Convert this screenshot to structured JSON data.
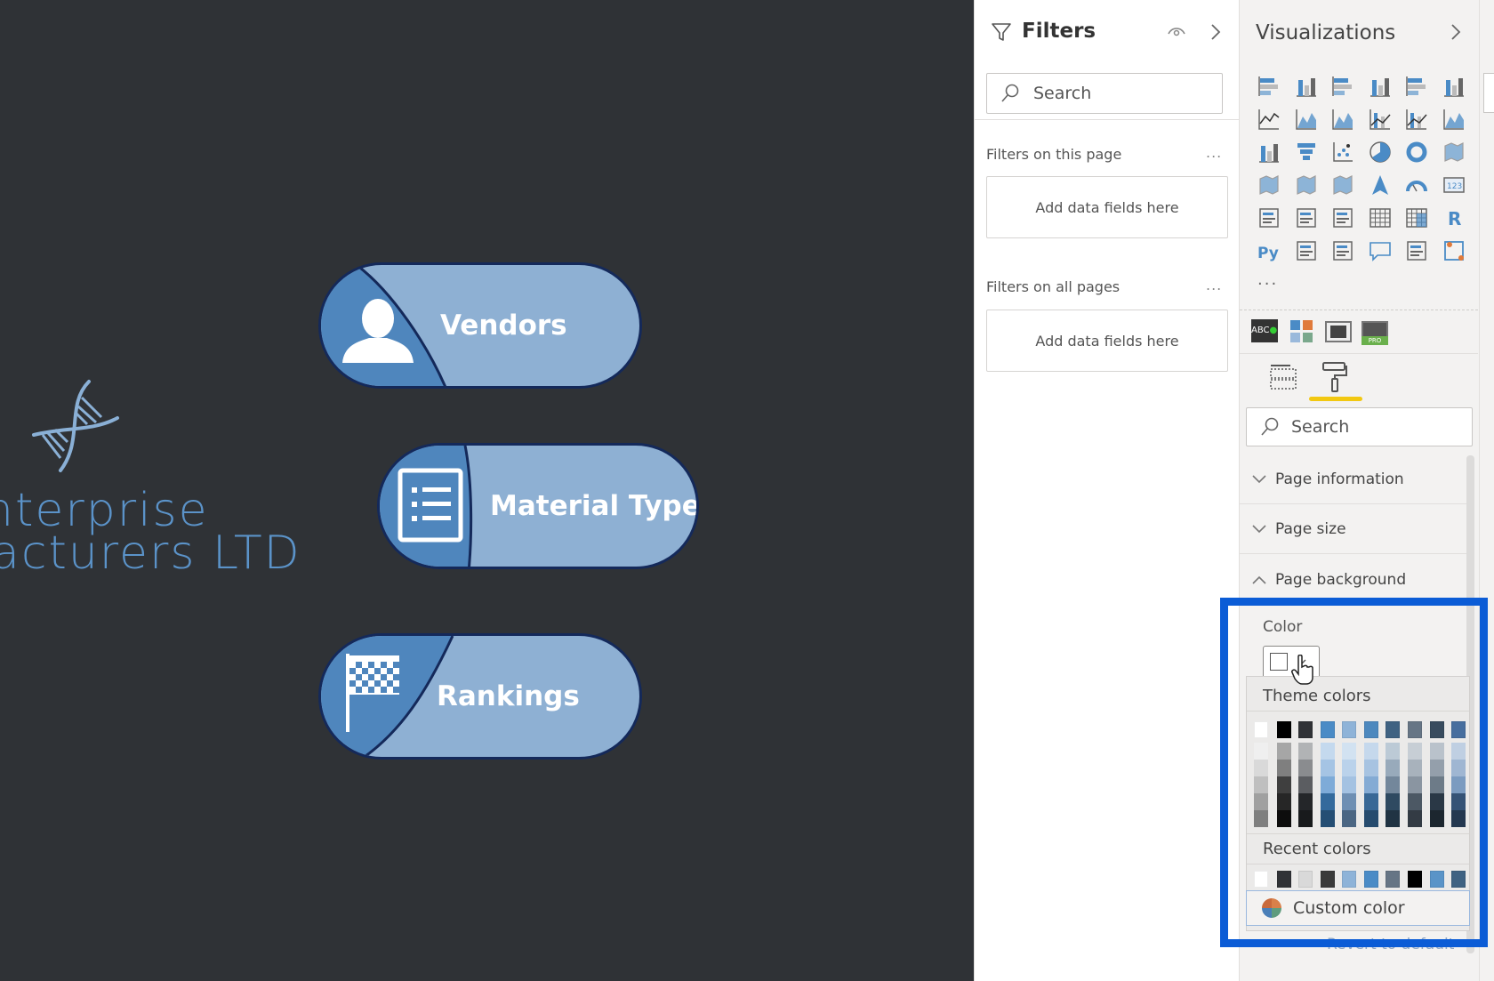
{
  "canvas": {
    "background_color": "#2f3236",
    "logo": {
      "line1": "nterprise",
      "line2": "acturers LTD",
      "icon": "dna-icon",
      "color": "#5b93c9"
    },
    "nav_buttons": [
      {
        "label": "Vendors",
        "icon": "person-icon"
      },
      {
        "label": "Material Type",
        "icon": "list-icon"
      },
      {
        "label": "Rankings",
        "icon": "checkered-flag-icon"
      }
    ],
    "pill_colors": {
      "fill": "#8eb0d3",
      "accent": "#4f86bd",
      "border": "#14295a"
    }
  },
  "filters_pane": {
    "title": "Filters",
    "search_placeholder": "Search",
    "sections": [
      {
        "label": "Filters on this page",
        "drop_text": "Add data fields here"
      },
      {
        "label": "Filters on all pages",
        "drop_text": "Add data fields here"
      }
    ],
    "more_label": "..."
  },
  "visualizations_pane": {
    "title": "Visualizations",
    "icons": [
      "stacked-bar-chart-icon",
      "stacked-column-chart-icon",
      "clustered-bar-chart-icon",
      "clustered-column-chart-icon",
      "100-stacked-bar-chart-icon",
      "100-stacked-column-chart-icon",
      "line-chart-icon",
      "area-chart-icon",
      "stacked-area-chart-icon",
      "line-and-stacked-column-chart-icon",
      "line-and-clustered-column-chart-icon",
      "ribbon-chart-icon",
      "waterfall-chart-icon",
      "funnel-icon",
      "scatter-chart-icon",
      "pie-chart-icon",
      "donut-chart-icon",
      "treemap-icon",
      "map-icon",
      "filled-map-icon",
      "shape-map-icon",
      "azure-map-icon",
      "gauge-icon",
      "card-icon",
      "multi-row-card-icon",
      "kpi-icon",
      "slicer-icon",
      "table-icon",
      "matrix-icon",
      "r-visual-icon",
      "python-visual-icon",
      "key-influencers-icon",
      "decomposition-tree-icon",
      "qna-icon",
      "paginated-report-icon",
      "power-automate-icon"
    ],
    "more_visuals_label": "...",
    "custom_visuals": [
      "text-filter-icon",
      "chiclet-slicer-icon",
      "image-visual-icon",
      "pro-visual-icon"
    ],
    "tabs": [
      {
        "name": "fields-tab",
        "active": false
      },
      {
        "name": "format-tab",
        "active": true
      }
    ],
    "format_search_placeholder": "Search",
    "format_sections": [
      {
        "label": "Page information",
        "expanded": false
      },
      {
        "label": "Page size",
        "expanded": false
      },
      {
        "label": "Page background",
        "expanded": true
      }
    ],
    "color_label": "Color",
    "color_value": "#ffffff",
    "revert_label": "Revert to default"
  },
  "color_picker": {
    "theme_heading": "Theme colors",
    "theme_colors": [
      "#ffffff",
      "#000000",
      "#303236",
      "#4a8bc6",
      "#8eb3d8",
      "#4c88be",
      "#3f6282",
      "#667585",
      "#384b5e",
      "#476e9e"
    ],
    "theme_shades": [
      [
        "#efefef",
        "#d9d9d9",
        "#bfbfbf",
        "#a0a0a0",
        "#7f7f7f"
      ],
      [
        "#a6a6a6",
        "#7f7f7f",
        "#3f3f3f",
        "#262626",
        "#0d0d0d"
      ],
      [
        "#b1b3b5",
        "#8a8c8f",
        "#5b5d61",
        "#242629",
        "#181a1c"
      ],
      [
        "#c4d9ee",
        "#a5c4e4",
        "#7eabd8",
        "#346a9c",
        "#254e74"
      ],
      [
        "#d2e2f1",
        "#bad2eb",
        "#a4c2e2",
        "#6e8fb3",
        "#4b6683"
      ],
      [
        "#c5d8ec",
        "#a7c3e1",
        "#84abd4",
        "#386896",
        "#264b6e"
      ],
      [
        "#bccad6",
        "#98aabb",
        "#73879b",
        "#2f4a61",
        "#203343"
      ],
      [
        "#c7ced5",
        "#a8b2bc",
        "#8a95a1",
        "#4c5864",
        "#333b44"
      ],
      [
        "#b9c2cb",
        "#949fab",
        "#6d7b88",
        "#2a3846",
        "#1c262f"
      ],
      [
        "#bfcfe2",
        "#9fb6d2",
        "#7b9bc0",
        "#355376",
        "#243850"
      ]
    ],
    "recent_heading": "Recent colors",
    "recent_colors": [
      "#ffffff",
      "#303236",
      "#d9d9d9",
      "#3a3a3a",
      "#8eb3d8",
      "#4a8bc6",
      "#667585",
      "#000000",
      "#5a94c8",
      "#3f6282"
    ],
    "custom_color_label": "Custom color"
  },
  "highlight_color": "#0b5cd6"
}
